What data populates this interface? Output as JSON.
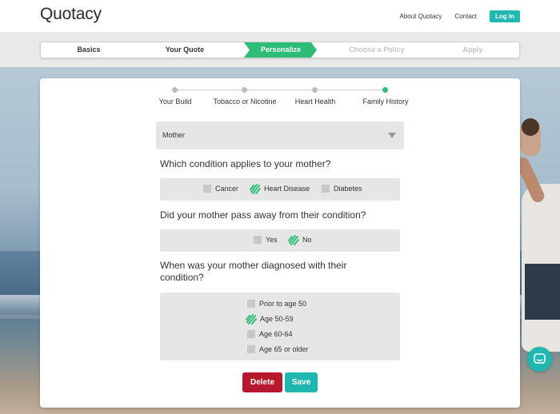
{
  "header": {
    "logo": "Quotacy",
    "nav": {
      "about": "About Quotacy",
      "contact": "Contact",
      "login": "Log In"
    }
  },
  "steps": [
    {
      "label": "Basics",
      "state": "complete"
    },
    {
      "label": "Your Quote",
      "state": "complete"
    },
    {
      "label": "Personalize",
      "state": "active"
    },
    {
      "label": "Choose a Policy",
      "state": "disabled"
    },
    {
      "label": "Apply",
      "state": "disabled"
    }
  ],
  "progress": [
    {
      "label": "Your Build",
      "done": false
    },
    {
      "label": "Tobacco or Nicotine",
      "done": false
    },
    {
      "label": "Heart Health",
      "done": false
    },
    {
      "label": "Family History",
      "done": true
    }
  ],
  "relative_select": {
    "value": "Mother"
  },
  "q1": {
    "text": "Which condition applies to your mother?",
    "options": [
      {
        "label": "Cancer",
        "checked": false
      },
      {
        "label": "Heart Disease",
        "checked": true
      },
      {
        "label": "Diabetes",
        "checked": false
      }
    ]
  },
  "q2": {
    "text": "Did your mother pass away from their condition?",
    "options": [
      {
        "label": "Yes",
        "checked": false
      },
      {
        "label": "No",
        "checked": true
      }
    ]
  },
  "q3": {
    "text": "When was your mother diagnosed with their condition?",
    "options": [
      {
        "label": "Prior to age 50",
        "checked": false
      },
      {
        "label": "Age 50-59",
        "checked": true
      },
      {
        "label": "Age 60-64",
        "checked": false
      },
      {
        "label": "Age 65 or older",
        "checked": false
      }
    ]
  },
  "actions": {
    "delete": "Delete",
    "save": "Save"
  },
  "colors": {
    "accent": "#1fb7b0",
    "active_step": "#2ebd77",
    "delete": "#b8182e",
    "check": "#2ebd77"
  },
  "icons": {
    "chat": "chat-bubble-icon",
    "check": "checkmark-scribble-icon",
    "dropdown": "caret-down-icon"
  }
}
